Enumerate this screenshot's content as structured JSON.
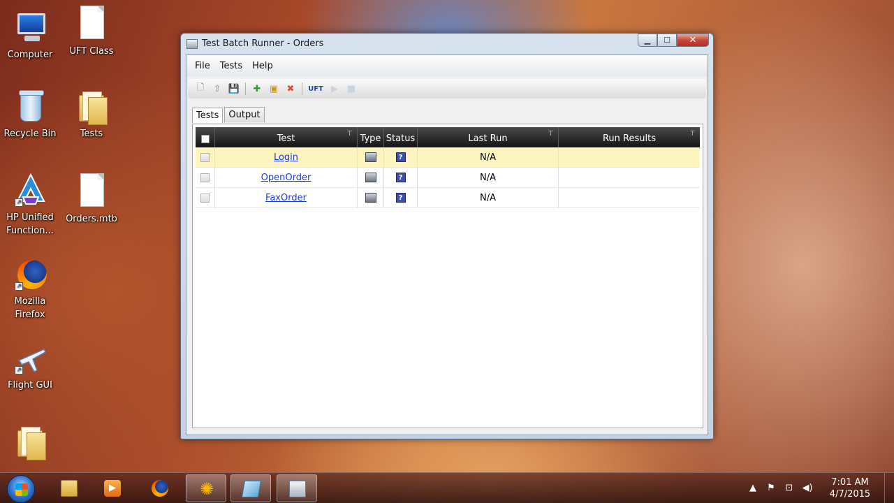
{
  "desktop": {
    "icons": [
      {
        "label": "Computer"
      },
      {
        "label": "UFT Class"
      },
      {
        "label": "Recycle Bin"
      },
      {
        "label": "Tests"
      },
      {
        "label": "HP Unified Function..."
      },
      {
        "label": "Orders.mtb"
      },
      {
        "label": "Mozilla Firefox"
      },
      {
        "label": "Flight GUI"
      }
    ]
  },
  "window": {
    "title": "Test Batch Runner - Orders",
    "menu": [
      "File",
      "Tests",
      "Help"
    ],
    "toolbar": {
      "uft_label": "UFT"
    },
    "tabs": [
      "Tests",
      "Output"
    ],
    "grid": {
      "columns": [
        "Test",
        "Type",
        "Status",
        "Last Run",
        "Run Results"
      ],
      "rows": [
        {
          "test": "Login",
          "last_run": "N/A",
          "run_results": ""
        },
        {
          "test": "OpenOrder",
          "last_run": "N/A",
          "run_results": ""
        },
        {
          "test": "FaxOrder",
          "last_run": "N/A",
          "run_results": ""
        }
      ]
    }
  },
  "taskbar": {
    "clock": {
      "time": "7:01 AM",
      "date": "4/7/2015"
    }
  },
  "colors": {
    "link": "#1a3bd6",
    "selected_row": "#fdf5c0",
    "grid_header": "#141414"
  }
}
